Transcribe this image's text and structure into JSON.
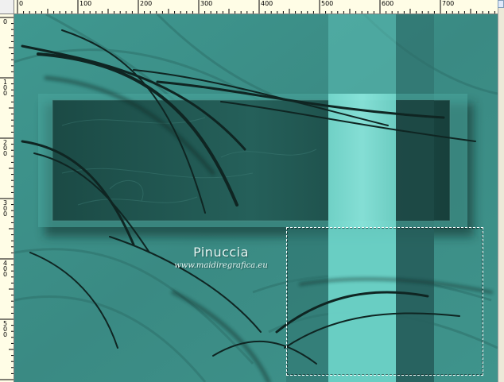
{
  "rulers": {
    "top_labels": [
      "0",
      "100",
      "200",
      "300",
      "400",
      "500",
      "600",
      "700"
    ],
    "left_labels": [
      "0",
      "100",
      "200",
      "300",
      "400",
      "500"
    ]
  },
  "canvas": {
    "watermark_name": "Pinuccia",
    "watermark_url": "www.maidiregrafica.eu"
  },
  "colors": {
    "background": "#3c8f88",
    "panel_dark": "#1d4f49",
    "stripe_light": "#7fe0d6",
    "stripe_dark": "#2a6a66",
    "ruler_bg": "#fffde6"
  },
  "icons": {
    "selection": "selection-marquee-icon"
  }
}
